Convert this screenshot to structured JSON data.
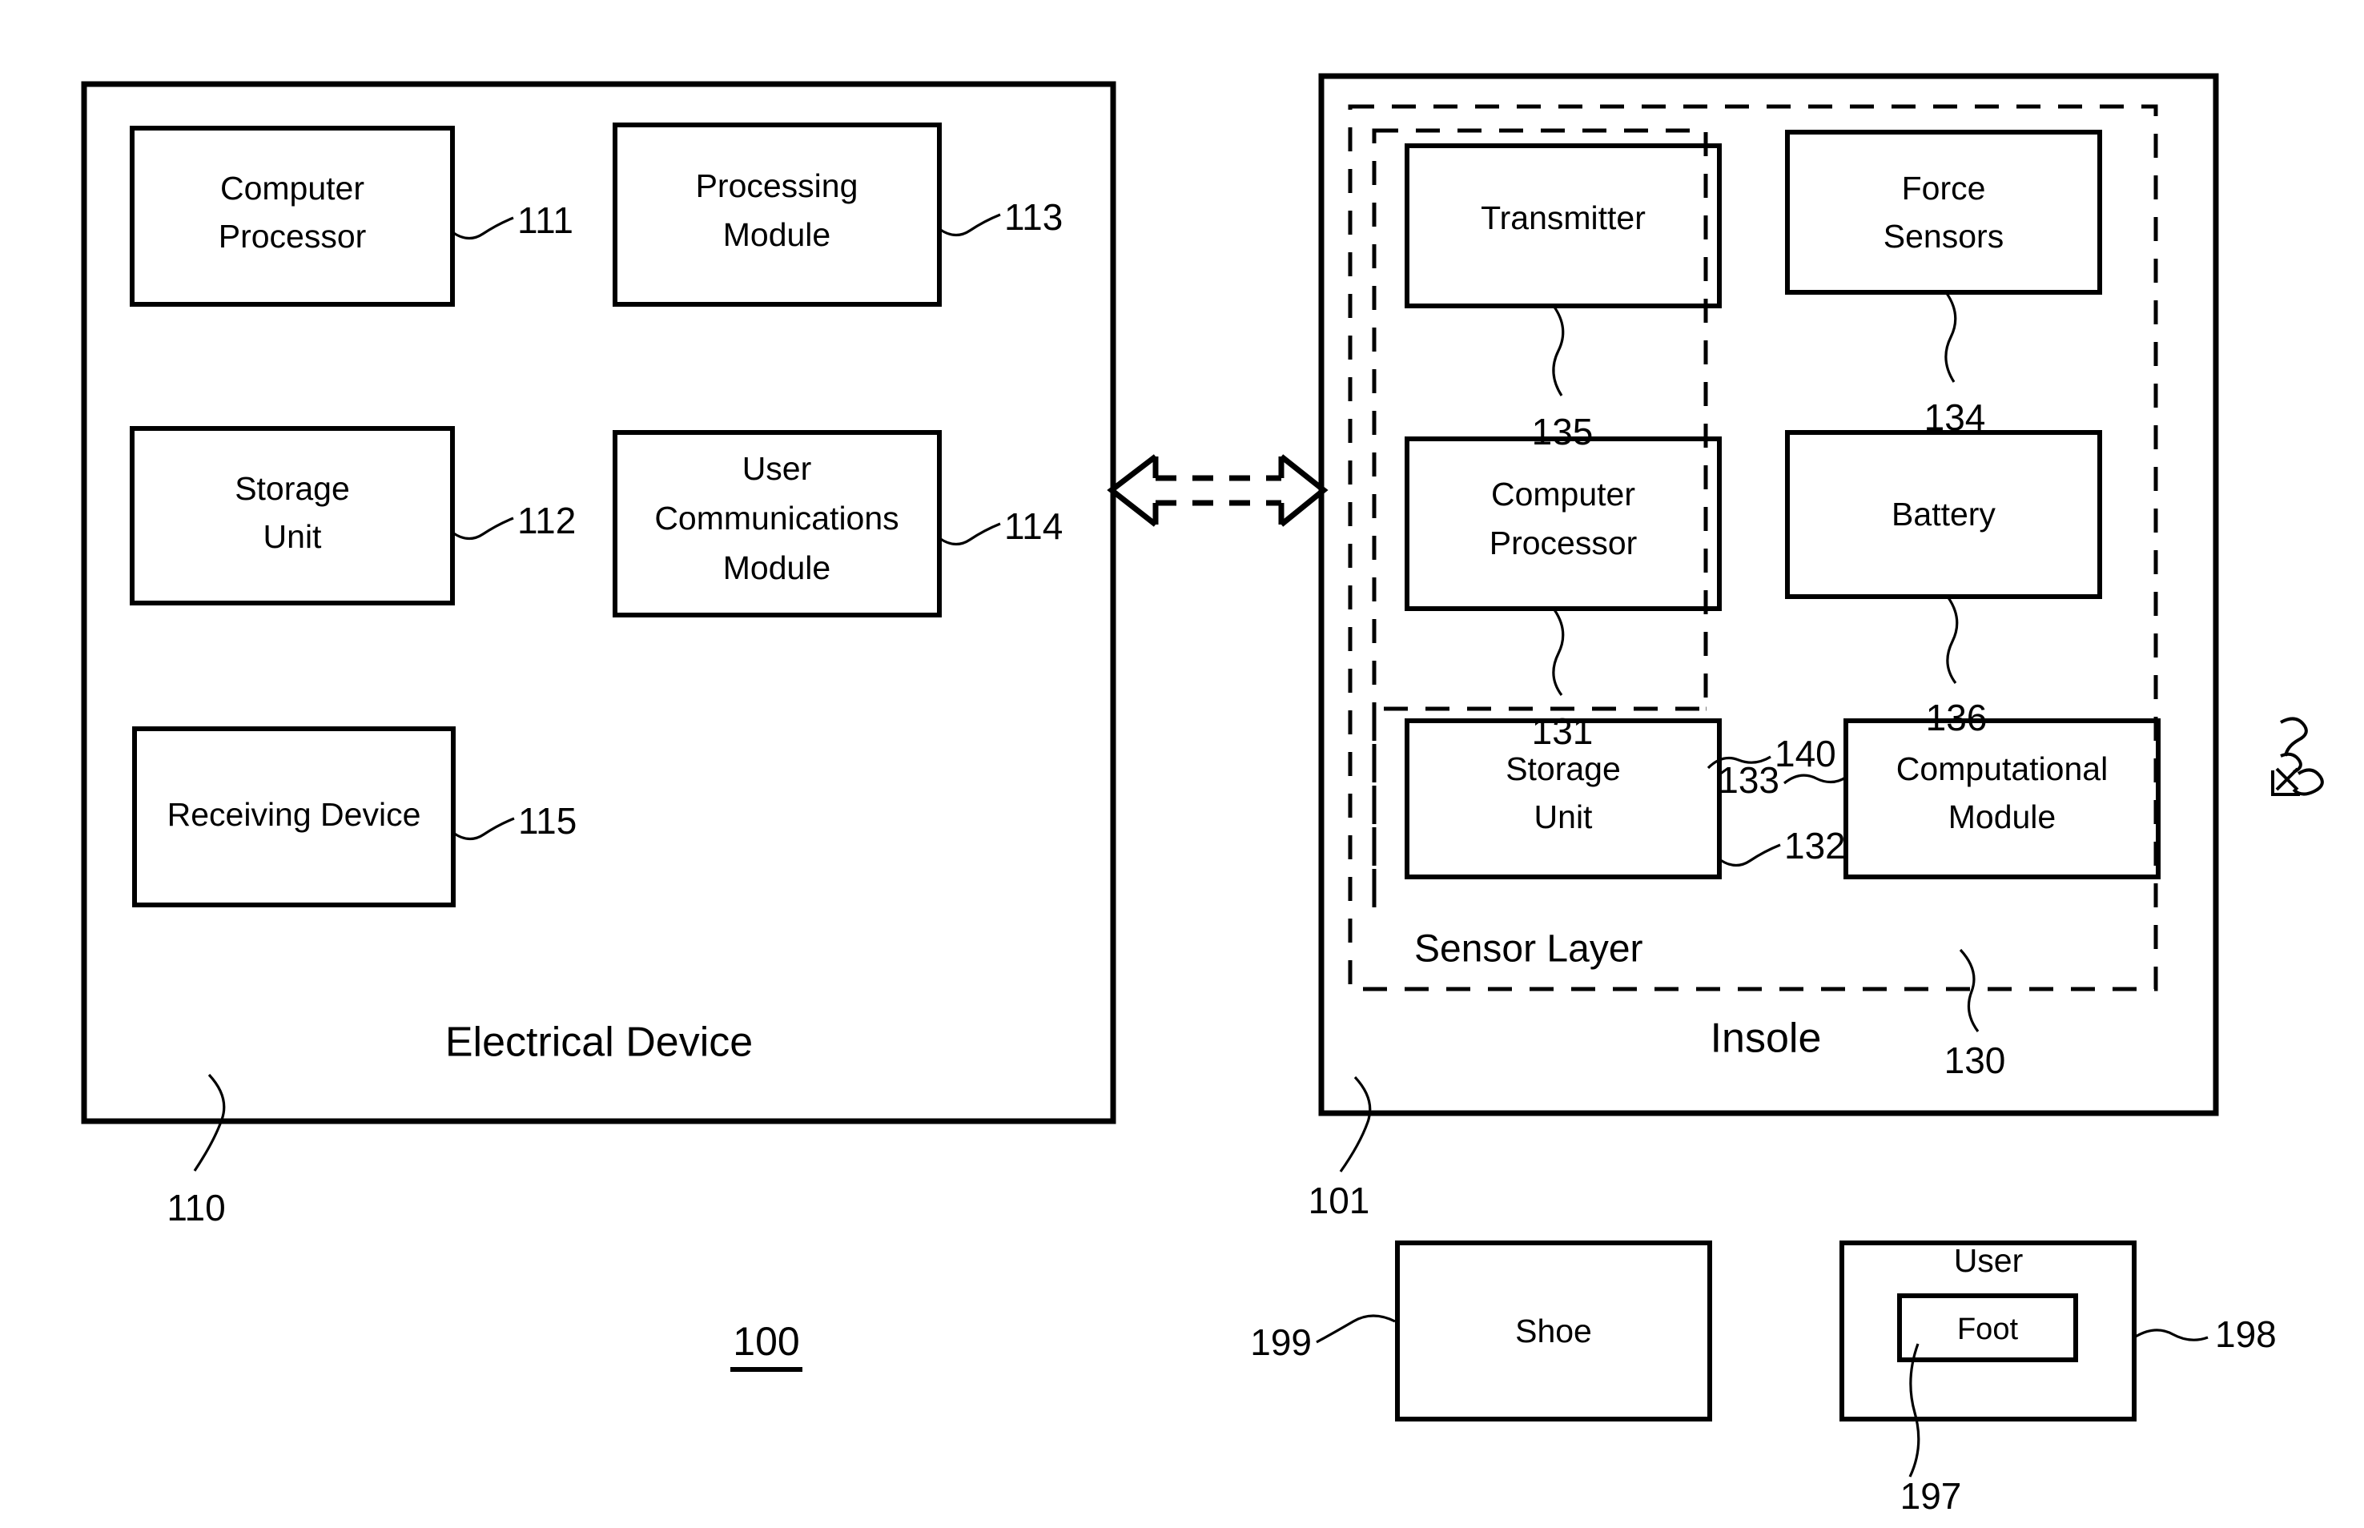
{
  "figure": {
    "figure_number": "100",
    "left_panel": {
      "title": "Electrical Device",
      "ref": "110",
      "blocks": [
        {
          "label_line1": "Computer",
          "label_line2": "Processor",
          "ref": "111"
        },
        {
          "label_line1": "Processing",
          "label_line2": "Module",
          "ref": "113"
        },
        {
          "label_line1": "Storage",
          "label_line2": "Unit",
          "ref": "112"
        },
        {
          "label_line1": "User",
          "label_line2": "Communications",
          "label_line3": "Module",
          "ref": "114"
        },
        {
          "label_line1": "Receiving Device",
          "label_line2": "",
          "ref": "115"
        }
      ]
    },
    "connector": {
      "type": "bidirectional-dashed-arrow"
    },
    "right_panel": {
      "title": "Insole",
      "ref": "101",
      "sensor_layer_label": "Sensor Layer",
      "sensor_layer_ref": "130",
      "inner_group_ref": "140",
      "blocks": [
        {
          "label_line1": "Transmitter",
          "label_line2": "",
          "ref": "135"
        },
        {
          "label_line1": "Force",
          "label_line2": "Sensors",
          "ref": "134"
        },
        {
          "label_line1": "Computer",
          "label_line2": "Processor",
          "ref": "131"
        },
        {
          "label_line1": "Battery",
          "label_line2": "",
          "ref": "136"
        },
        {
          "label_line1": "Storage",
          "label_line2": "Unit",
          "ref": "132"
        },
        {
          "label_line1": "Computational",
          "label_line2": "Module",
          "ref": "133"
        }
      ]
    },
    "bottom": {
      "shoe": {
        "label": "Shoe",
        "ref": "199"
      },
      "user": {
        "label": "User",
        "ref": "198"
      },
      "foot": {
        "label": "Foot",
        "ref": "197"
      }
    }
  }
}
